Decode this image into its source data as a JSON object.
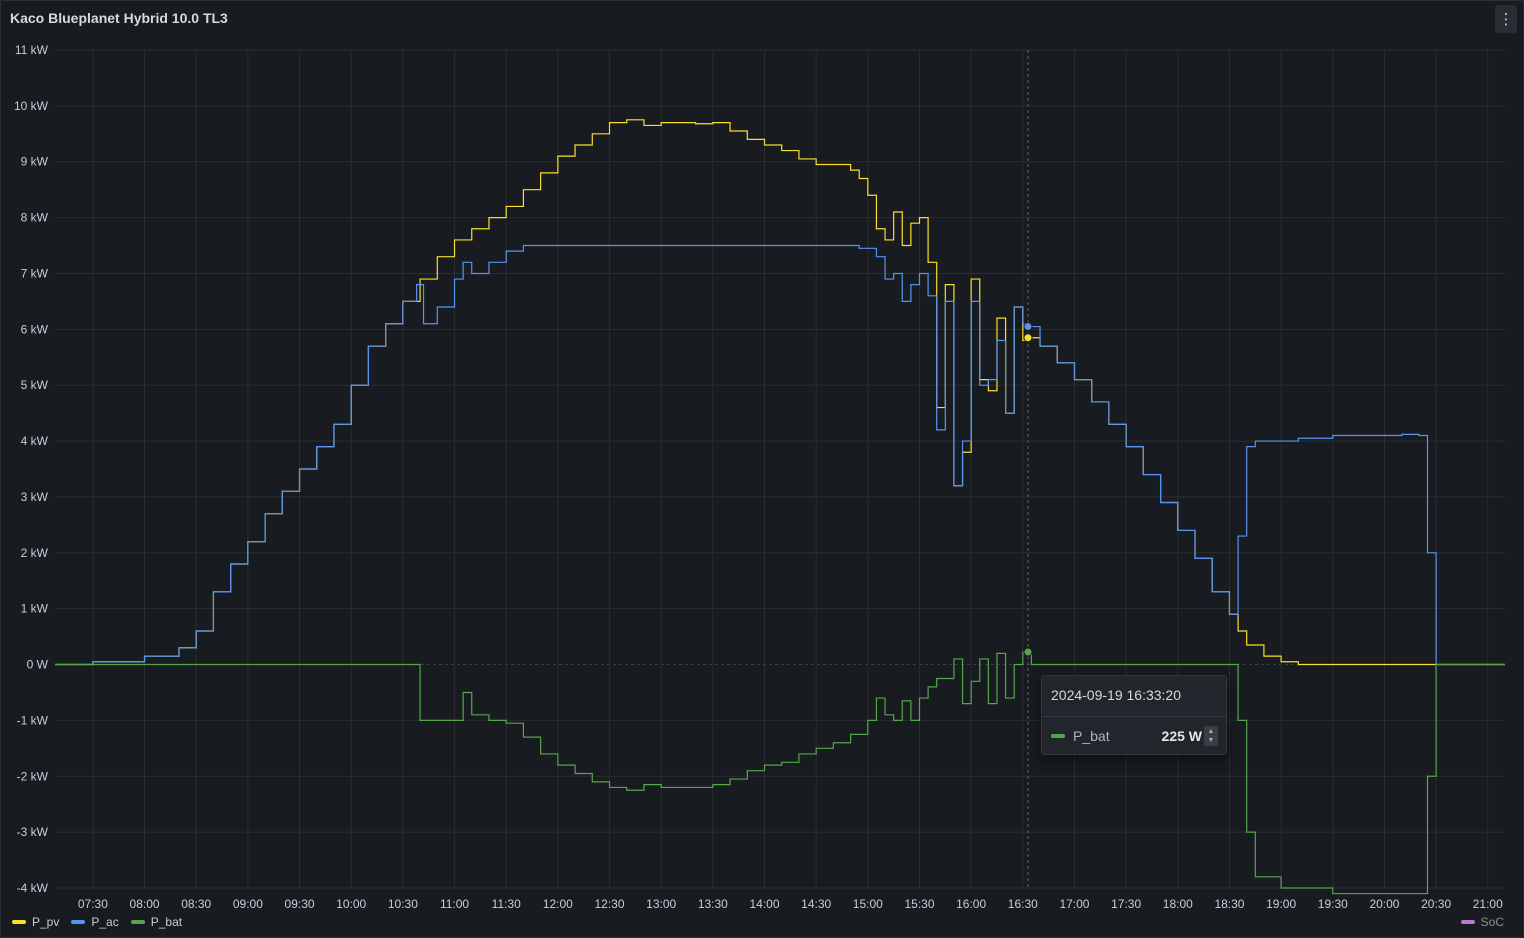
{
  "panel": {
    "title": "Kaco Blueplanet Hybrid 10.0 TL3",
    "menu_icon": "kebab-icon"
  },
  "chart_data": {
    "type": "line",
    "title": "Kaco Blueplanet Hybrid 10.0 TL3",
    "xlabel": "",
    "ylabel": "",
    "x_unit": "time",
    "xlim": [
      "07:08",
      "21:10"
    ],
    "ylim": [
      -4,
      11
    ],
    "y_unit": "kW",
    "grid": true,
    "legend_placement": "bottom-left",
    "y_ticks": [
      "-4 kW",
      "-3 kW",
      "-2 kW",
      "-1 kW",
      "0 W",
      "1 kW",
      "2 kW",
      "3 kW",
      "4 kW",
      "5 kW",
      "6 kW",
      "7 kW",
      "8 kW",
      "9 kW",
      "10 kW",
      "11 kW"
    ],
    "x_ticks": [
      "07:30",
      "08:00",
      "08:30",
      "09:00",
      "09:30",
      "10:00",
      "10:30",
      "11:00",
      "11:30",
      "12:00",
      "12:30",
      "13:00",
      "13:30",
      "14:00",
      "14:30",
      "15:00",
      "15:30",
      "16:00",
      "16:30",
      "17:00",
      "17:30",
      "18:00",
      "18:30",
      "19:00",
      "19:30",
      "20:00",
      "20:30",
      "21:00"
    ],
    "series": [
      {
        "name": "P_pv",
        "color": "#fade2a",
        "points": [
          [
            "07:08",
            0
          ],
          [
            "07:30",
            0.05
          ],
          [
            "08:00",
            0.15
          ],
          [
            "08:20",
            0.3
          ],
          [
            "08:30",
            0.6
          ],
          [
            "08:40",
            1.3
          ],
          [
            "08:50",
            1.8
          ],
          [
            "09:00",
            2.2
          ],
          [
            "09:10",
            2.7
          ],
          [
            "09:20",
            3.1
          ],
          [
            "09:30",
            3.5
          ],
          [
            "09:40",
            3.9
          ],
          [
            "09:50",
            4.3
          ],
          [
            "10:00",
            5.0
          ],
          [
            "10:10",
            5.7
          ],
          [
            "10:20",
            6.1
          ],
          [
            "10:30",
            6.5
          ],
          [
            "10:40",
            6.9
          ],
          [
            "10:50",
            7.3
          ],
          [
            "11:00",
            7.6
          ],
          [
            "11:10",
            7.8
          ],
          [
            "11:20",
            8.0
          ],
          [
            "11:30",
            8.2
          ],
          [
            "11:40",
            8.5
          ],
          [
            "11:50",
            8.8
          ],
          [
            "12:00",
            9.1
          ],
          [
            "12:10",
            9.3
          ],
          [
            "12:20",
            9.5
          ],
          [
            "12:30",
            9.7
          ],
          [
            "12:40",
            9.75
          ],
          [
            "12:50",
            9.65
          ],
          [
            "13:00",
            9.7
          ],
          [
            "13:10",
            9.7
          ],
          [
            "13:20",
            9.68
          ],
          [
            "13:30",
            9.7
          ],
          [
            "13:40",
            9.55
          ],
          [
            "13:50",
            9.4
          ],
          [
            "14:00",
            9.3
          ],
          [
            "14:10",
            9.2
          ],
          [
            "14:20",
            9.05
          ],
          [
            "14:30",
            8.95
          ],
          [
            "14:40",
            8.95
          ],
          [
            "14:50",
            8.85
          ],
          [
            "14:55",
            8.7
          ],
          [
            "15:00",
            8.4
          ],
          [
            "15:05",
            7.8
          ],
          [
            "15:10",
            7.6
          ],
          [
            "15:15",
            8.1
          ],
          [
            "15:20",
            7.5
          ],
          [
            "15:25",
            7.9
          ],
          [
            "15:30",
            8.0
          ],
          [
            "15:35",
            7.2
          ],
          [
            "15:40",
            4.6
          ],
          [
            "15:45",
            6.8
          ],
          [
            "15:50",
            3.2
          ],
          [
            "15:55",
            3.8
          ],
          [
            "16:00",
            6.9
          ],
          [
            "16:05",
            5.1
          ],
          [
            "16:10",
            4.9
          ],
          [
            "16:15",
            6.2
          ],
          [
            "16:20",
            4.5
          ],
          [
            "16:25",
            6.4
          ],
          [
            "16:30",
            5.8
          ],
          [
            "16:33",
            5.85
          ],
          [
            "16:40",
            5.7
          ],
          [
            "16:50",
            5.4
          ],
          [
            "17:00",
            5.1
          ],
          [
            "17:10",
            4.7
          ],
          [
            "17:20",
            4.3
          ],
          [
            "17:30",
            3.9
          ],
          [
            "17:40",
            3.4
          ],
          [
            "17:50",
            2.9
          ],
          [
            "18:00",
            2.4
          ],
          [
            "18:10",
            1.9
          ],
          [
            "18:20",
            1.3
          ],
          [
            "18:30",
            0.9
          ],
          [
            "18:35",
            0.6
          ],
          [
            "18:40",
            0.35
          ],
          [
            "18:50",
            0.15
          ],
          [
            "19:00",
            0.05
          ],
          [
            "19:10",
            0.0
          ],
          [
            "21:10",
            0
          ]
        ]
      },
      {
        "name": "P_ac",
        "color": "#5794f2",
        "points": [
          [
            "07:08",
            0
          ],
          [
            "07:30",
            0.05
          ],
          [
            "08:00",
            0.15
          ],
          [
            "08:20",
            0.3
          ],
          [
            "08:30",
            0.6
          ],
          [
            "08:40",
            1.3
          ],
          [
            "08:50",
            1.8
          ],
          [
            "09:00",
            2.2
          ],
          [
            "09:10",
            2.7
          ],
          [
            "09:20",
            3.1
          ],
          [
            "09:30",
            3.5
          ],
          [
            "09:40",
            3.9
          ],
          [
            "09:50",
            4.3
          ],
          [
            "10:00",
            5.0
          ],
          [
            "10:10",
            5.7
          ],
          [
            "10:20",
            6.1
          ],
          [
            "10:30",
            6.5
          ],
          [
            "10:38",
            6.8
          ],
          [
            "10:42",
            6.1
          ],
          [
            "10:50",
            6.4
          ],
          [
            "11:00",
            6.9
          ],
          [
            "11:05",
            7.2
          ],
          [
            "11:10",
            7.0
          ],
          [
            "11:20",
            7.2
          ],
          [
            "11:30",
            7.4
          ],
          [
            "11:40",
            7.5
          ],
          [
            "12:00",
            7.5
          ],
          [
            "13:00",
            7.5
          ],
          [
            "14:00",
            7.5
          ],
          [
            "14:40",
            7.5
          ],
          [
            "14:55",
            7.45
          ],
          [
            "15:05",
            7.3
          ],
          [
            "15:10",
            6.9
          ],
          [
            "15:15",
            7.0
          ],
          [
            "15:20",
            6.5
          ],
          [
            "15:25",
            6.8
          ],
          [
            "15:30",
            7.0
          ],
          [
            "15:35",
            6.6
          ],
          [
            "15:40",
            4.2
          ],
          [
            "15:45",
            6.5
          ],
          [
            "15:50",
            3.2
          ],
          [
            "15:55",
            4.0
          ],
          [
            "16:00",
            6.5
          ],
          [
            "16:05",
            5.0
          ],
          [
            "16:10",
            5.1
          ],
          [
            "16:15",
            5.8
          ],
          [
            "16:20",
            4.5
          ],
          [
            "16:25",
            6.4
          ],
          [
            "16:30",
            6.1
          ],
          [
            "16:33",
            6.05
          ],
          [
            "16:40",
            5.7
          ],
          [
            "16:50",
            5.4
          ],
          [
            "17:00",
            5.1
          ],
          [
            "17:10",
            4.7
          ],
          [
            "17:20",
            4.3
          ],
          [
            "17:30",
            3.9
          ],
          [
            "17:40",
            3.4
          ],
          [
            "17:50",
            2.9
          ],
          [
            "18:00",
            2.4
          ],
          [
            "18:10",
            1.9
          ],
          [
            "18:20",
            1.3
          ],
          [
            "18:30",
            0.9
          ],
          [
            "18:35",
            2.3
          ],
          [
            "18:40",
            3.9
          ],
          [
            "18:45",
            4.0
          ],
          [
            "19:00",
            4.0
          ],
          [
            "19:10",
            4.05
          ],
          [
            "19:30",
            4.1
          ],
          [
            "20:00",
            4.1
          ],
          [
            "20:10",
            4.12
          ],
          [
            "20:20",
            4.1
          ],
          [
            "20:25",
            2.0
          ],
          [
            "20:30",
            0.0
          ],
          [
            "21:10",
            0
          ]
        ]
      },
      {
        "name": "P_bat",
        "color": "#56a64b",
        "points": [
          [
            "07:08",
            0
          ],
          [
            "10:35",
            0
          ],
          [
            "10:40",
            -1.0
          ],
          [
            "11:00",
            -1.0
          ],
          [
            "11:05",
            -0.5
          ],
          [
            "11:10",
            -0.9
          ],
          [
            "11:20",
            -1.0
          ],
          [
            "11:30",
            -1.05
          ],
          [
            "11:40",
            -1.3
          ],
          [
            "11:50",
            -1.6
          ],
          [
            "12:00",
            -1.8
          ],
          [
            "12:10",
            -1.95
          ],
          [
            "12:20",
            -2.1
          ],
          [
            "12:30",
            -2.2
          ],
          [
            "12:40",
            -2.25
          ],
          [
            "12:50",
            -2.15
          ],
          [
            "13:00",
            -2.2
          ],
          [
            "13:10",
            -2.2
          ],
          [
            "13:20",
            -2.2
          ],
          [
            "13:30",
            -2.15
          ],
          [
            "13:40",
            -2.05
          ],
          [
            "13:50",
            -1.9
          ],
          [
            "14:00",
            -1.8
          ],
          [
            "14:10",
            -1.75
          ],
          [
            "14:20",
            -1.6
          ],
          [
            "14:30",
            -1.5
          ],
          [
            "14:40",
            -1.4
          ],
          [
            "14:50",
            -1.25
          ],
          [
            "15:00",
            -1.0
          ],
          [
            "15:05",
            -0.6
          ],
          [
            "15:10",
            -0.9
          ],
          [
            "15:15",
            -1.0
          ],
          [
            "15:20",
            -0.65
          ],
          [
            "15:25",
            -1.0
          ],
          [
            "15:30",
            -0.6
          ],
          [
            "15:35",
            -0.4
          ],
          [
            "15:40",
            -0.25
          ],
          [
            "15:50",
            0.1
          ],
          [
            "15:55",
            -0.7
          ],
          [
            "16:00",
            -0.3
          ],
          [
            "16:05",
            0.1
          ],
          [
            "16:10",
            -0.7
          ],
          [
            "16:15",
            0.2
          ],
          [
            "16:20",
            -0.6
          ],
          [
            "16:25",
            0.0
          ],
          [
            "16:30",
            0.22
          ],
          [
            "16:33",
            0.225
          ],
          [
            "16:35",
            0.0
          ],
          [
            "18:30",
            0.0
          ],
          [
            "18:35",
            -1.0
          ],
          [
            "18:40",
            -3.0
          ],
          [
            "18:45",
            -3.8
          ],
          [
            "19:00",
            -4.0
          ],
          [
            "19:30",
            -4.1
          ],
          [
            "20:00",
            -4.1
          ],
          [
            "20:20",
            -4.1
          ],
          [
            "20:25",
            -2.0
          ],
          [
            "20:30",
            0.0
          ],
          [
            "21:10",
            0
          ]
        ]
      }
    ],
    "extra_legend": [
      {
        "name": "SoC",
        "color": "#b877d9"
      }
    ],
    "crosshair_x": "16:33",
    "tooltip": {
      "time": "2024-09-19 16:33:20",
      "series": "P_bat",
      "value": "225 W"
    }
  },
  "legend": {
    "items": [
      {
        "label": "P_pv",
        "color": "#fade2a"
      },
      {
        "label": "P_ac",
        "color": "#5794f2"
      },
      {
        "label": "P_bat",
        "color": "#56a64b"
      }
    ],
    "right": {
      "label": "SoC",
      "color": "#b877d9"
    }
  }
}
